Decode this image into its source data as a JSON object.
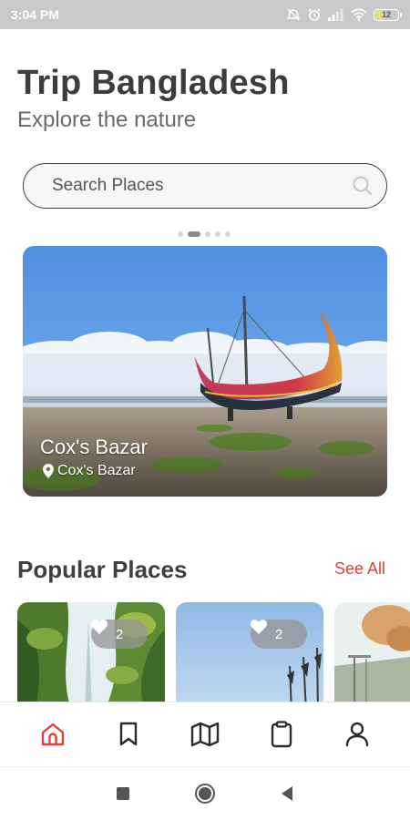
{
  "status_bar": {
    "time": "3:04 PM",
    "battery_level": "12",
    "icons": [
      "alarm-off-icon",
      "alarm-icon",
      "signal-icon",
      "wifi-icon",
      "battery-icon"
    ]
  },
  "header": {
    "title": "Trip Bangladesh",
    "subtitle": "Explore the nature"
  },
  "search": {
    "placeholder": "Search Places",
    "icon": "search-icon"
  },
  "carousel": {
    "page_count": 5,
    "active_index": 1,
    "featured": {
      "name": "Cox's Bazar",
      "location": "Cox's Bazar"
    }
  },
  "popular": {
    "title": "Popular Places",
    "see_all_label": "See All",
    "cards": [
      {
        "likes": "2"
      },
      {
        "likes": "2"
      }
    ]
  },
  "bottom_nav": {
    "items": [
      "home-icon",
      "bookmark-icon",
      "map-icon",
      "clipboard-icon",
      "profile-icon"
    ],
    "active": "home-icon",
    "active_color": "#e0403a",
    "inactive_color": "#2b2b2b"
  },
  "system_nav": {
    "items": [
      "recents-button",
      "home-button",
      "back-button"
    ]
  }
}
